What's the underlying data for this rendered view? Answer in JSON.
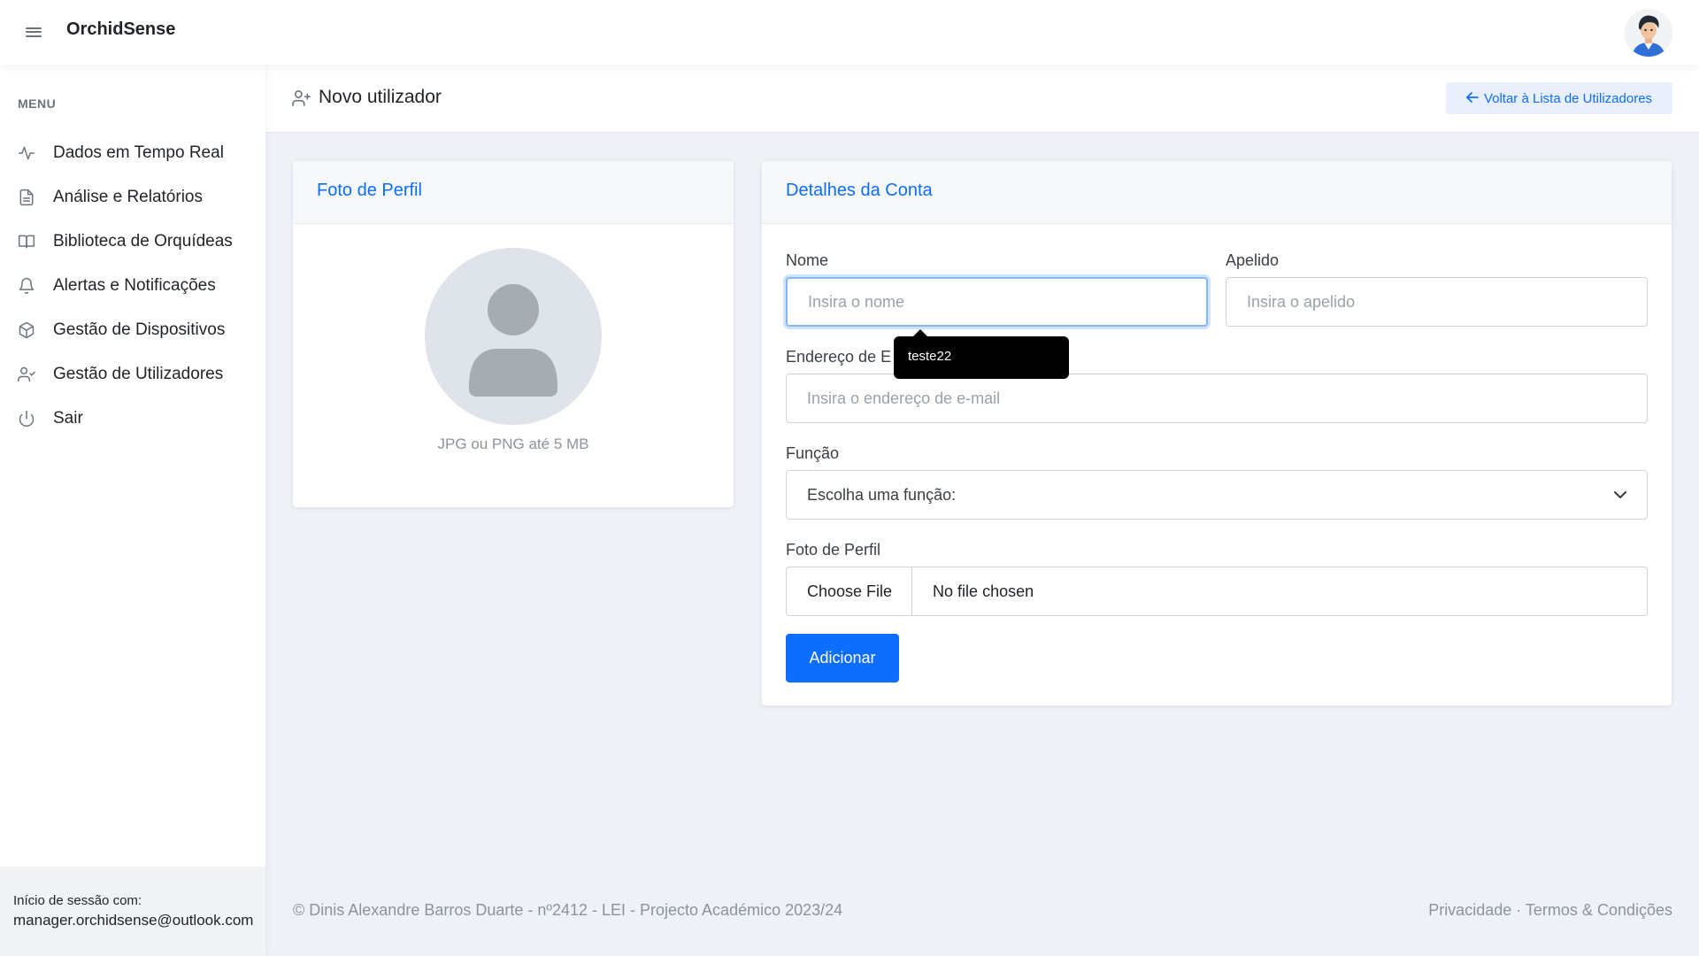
{
  "topbar": {
    "brand": "OrchidSense"
  },
  "sidebar": {
    "heading": "MENU",
    "items": [
      {
        "label": "Dados em Tempo Real",
        "icon": "activity-icon"
      },
      {
        "label": "Análise e Relatórios",
        "icon": "document-icon"
      },
      {
        "label": "Biblioteca de Orquídeas",
        "icon": "book-icon"
      },
      {
        "label": "Alertas e Notificações",
        "icon": "bell-icon"
      },
      {
        "label": "Gestão de Dispositivos",
        "icon": "box-icon"
      },
      {
        "label": "Gestão de Utilizadores",
        "icon": "user-check-icon"
      },
      {
        "label": "Sair",
        "icon": "power-icon"
      }
    ],
    "session_label": "Início de sessão com:",
    "session_email": "manager.orchidsense@outlook.com"
  },
  "header": {
    "title": "Novo utilizador",
    "back_label": "Voltar à Lista de Utilizadores"
  },
  "profile_card": {
    "title": "Foto de Perfil",
    "hint": "JPG ou PNG até 5 MB"
  },
  "account_card": {
    "title": "Detalhes da Conta",
    "first_name_label": "Nome",
    "first_name_placeholder": "Insira o nome",
    "last_name_label": "Apelido",
    "last_name_placeholder": "Insira o apelido",
    "email_label": "Endereço de E",
    "email_placeholder": "Insira o endereço de e-mail",
    "role_label": "Função",
    "role_selected": "Escolha uma função:",
    "photo_label": "Foto de Perfil",
    "file_button": "Choose File",
    "file_status": "No file chosen",
    "submit_label": "Adicionar"
  },
  "autofill_tooltip": "teste22",
  "footer": {
    "copyright": "© Dinis Alexandre Barros Duarte - nº2412 - LEI - Projecto Académico 2023/24",
    "privacy": "Privacidade",
    "separator": " · ",
    "terms": "Termos & Condições"
  },
  "colors": {
    "accent": "#0d6efd",
    "sidebar_bg": "#ffffff",
    "page_bg": "#eef2f7",
    "focus_ring": "#86b7fe"
  }
}
